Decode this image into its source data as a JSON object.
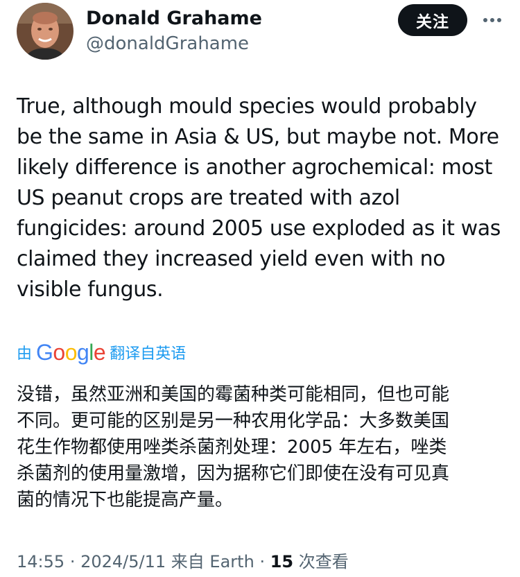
{
  "author": {
    "display_name": "Donald Grahame",
    "handle": "@donaldGrahame"
  },
  "follow_label": "关注",
  "more_icon": "more-horizontal-icon",
  "tweet_lines": [
    "True, although mould species would probably",
    "be the same in Asia & US, but maybe not. More",
    "likely difference is another agrochemical: most",
    "US peanut crops are treated with azol",
    "fungicides: around 2005 use exploded as it was",
    "claimed they increased yield even with no",
    "visible fungus."
  ],
  "translation": {
    "prefix": "由",
    "brand": "Google",
    "suffix": "翻译自英语"
  },
  "translated_lines": [
    "没错，虽然亚洲和美国的霉菌种类可能相同，但也可能",
    "不同。更可能的区别是另一种农用化学品：大多数美国",
    "花生作物都使用唑类杀菌剂处理：2005 年左右，唑类",
    "杀菌剂的使用量激增，因为据称它们即使在没有可见真",
    "菌的情况下也能提高产量。"
  ],
  "meta": {
    "time": "14:55",
    "separator": "·",
    "date": "2024/5/11",
    "source": "来自 Earth",
    "views_count": "15",
    "views_label": "次查看"
  },
  "colors": {
    "text": "#0f1419",
    "secondary": "#536471",
    "link": "#1d9bf0",
    "follow_bg": "#0f1419",
    "google_blue": "#4285f4",
    "google_red": "#ea4335",
    "google_yellow": "#fbbc05",
    "google_green": "#34a853"
  }
}
